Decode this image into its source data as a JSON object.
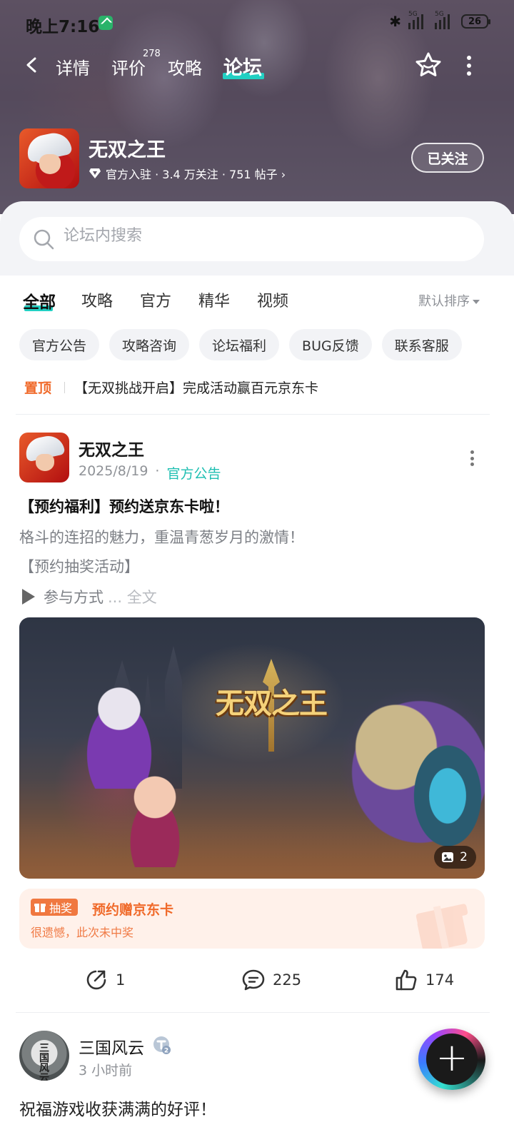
{
  "status_bar": {
    "time": "晚上7:16",
    "network_1": "5G",
    "network_2": "5G",
    "battery": "26"
  },
  "nav": {
    "tabs": [
      {
        "label": "详情"
      },
      {
        "label": "评价",
        "badge": "278"
      },
      {
        "label": "攻略"
      },
      {
        "label": "论坛",
        "active": true
      }
    ]
  },
  "game": {
    "name": "无双之王",
    "meta": "官方入驻 · 3.4 万关注 · 751 帖子 ›",
    "follow_label": "已关注"
  },
  "search": {
    "placeholder": "论坛内搜索"
  },
  "filters": {
    "tabs": [
      "全部",
      "攻略",
      "官方",
      "精华",
      "视频"
    ],
    "active": "全部",
    "sort_label": "默认排序"
  },
  "chips": [
    "官方公告",
    "攻略咨询",
    "论坛福利",
    "BUG反馈",
    "联系客服"
  ],
  "pinned": {
    "tag": "置顶",
    "title": "【无双挑战开启】完成活动赢百元京东卡"
  },
  "post": {
    "author": "无双之王",
    "date": "2025/8/19",
    "separator": "·",
    "category": "官方公告",
    "title": "【预约福利】预约送京东卡啦！",
    "line1": "格斗的连招的魅力，重温青葱岁月的激情！",
    "line2": "【预约抽奖活动】",
    "line3": "参与方式",
    "read_more": "... 全文",
    "image_title": "无双之王",
    "image_count": "2",
    "lottery": {
      "badge": "抽奖",
      "title": "预约赠京东卡",
      "result": "很遗憾，此次未中奖"
    },
    "shares": "1",
    "comments": "225",
    "likes": "174"
  },
  "post2": {
    "author": "三国风云",
    "avatar_text": "三国风云",
    "level_badge": "2",
    "time": "3 小时前",
    "text": "祝福游戏收获满满的好评！"
  },
  "colors": {
    "accent": "#22d0c3",
    "category": "#1fbfb2",
    "pinned_tag": "#f06a2a",
    "lottery_bg": "#fff1ea"
  }
}
